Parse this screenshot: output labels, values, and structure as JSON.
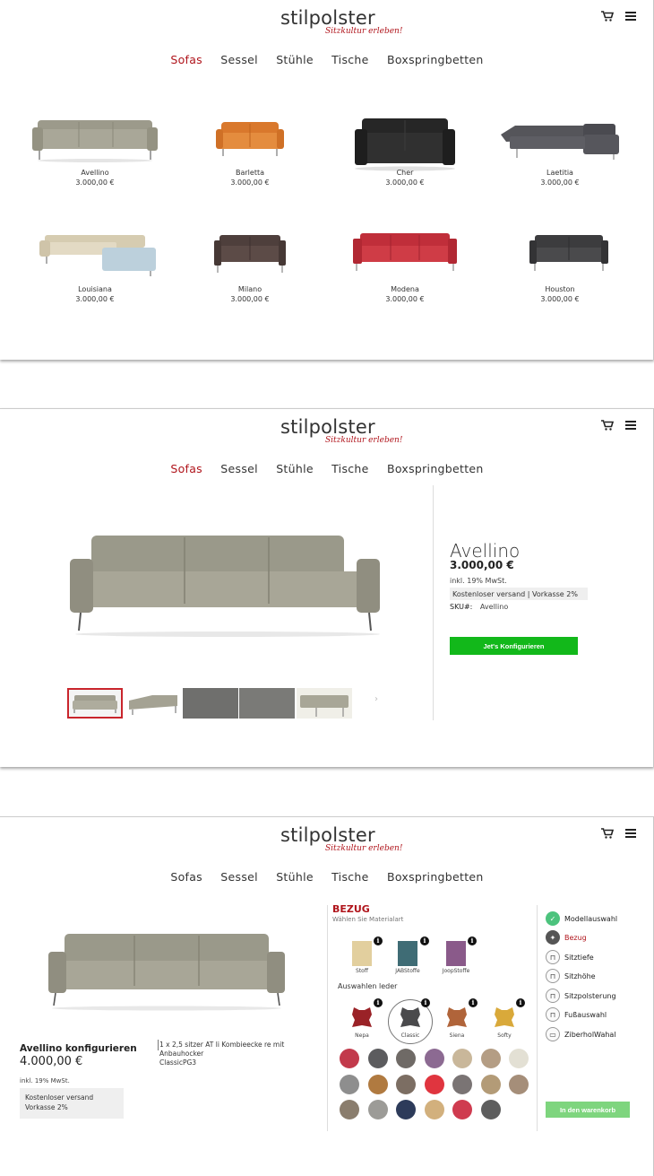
{
  "header": {
    "brand": "stilpolster",
    "tagline": "Sitzkultur erleben!",
    "nav": [
      "Sofas",
      "Sessel",
      "Stühle",
      "Tische",
      "Boxspringbetten"
    ]
  },
  "catalog": {
    "items": [
      {
        "name": "Avellino",
        "price": "3.000,00 €",
        "color": "#a4a293"
      },
      {
        "name": "Barletta",
        "price": "3.000,00 €",
        "color": "#e08a3c"
      },
      {
        "name": "Cher",
        "price": "3.000,00 €",
        "color": "#2b2b2b"
      },
      {
        "name": "Laetitia",
        "price": "3.000,00 €",
        "color": "#4c4c52"
      },
      {
        "name": "Louisiana",
        "price": "3.000,00 €",
        "color": "#d8cdb4"
      },
      {
        "name": "Milano",
        "price": "3.000,00 €",
        "color": "#5a4a46"
      },
      {
        "name": "Modena",
        "price": "3.000,00 €",
        "color": "#c4343c"
      },
      {
        "name": "Houston",
        "price": "3.000,00 €",
        "color": "#444446"
      }
    ]
  },
  "detail": {
    "name": "Avellino",
    "price": "3.000,00 €",
    "tax": "inkl. 19% MwSt.",
    "shipping": "Kostenloser versand | Vorkasse 2%",
    "sku_label": "SKU#:",
    "sku": "Avellino",
    "cta": "Jet's Konfigurieren"
  },
  "configurator": {
    "title": "Avellino konfigurieren",
    "price": "4.000,00 €",
    "tax": "inkl. 19% MwSt.",
    "shipping_line1": "Kostenloser versand",
    "shipping_line2": "Vorkasse 2%",
    "summary_line1": "1 x 2,5 sitzer AT li Kombieecke re mit Anbauhocker",
    "summary_line2": "ClassicPG3",
    "section_title": "BEZUG",
    "section_sub": "Wählen Sie Materialart",
    "materials": [
      "Stoff",
      "JABStoffe",
      "JoopStoffe"
    ],
    "leather_label": "Auswahlen leder",
    "leathers": [
      "Nepa",
      "Classic",
      "Siena",
      "Softy"
    ],
    "steps": [
      "Modellauswahl",
      "Bezug",
      "Sitztiefe",
      "Sitzhöhe",
      "Sitzpolsterung",
      "Fußauswahl",
      "ZiberholWahal"
    ],
    "cart_button": "In den warenkorb",
    "accent": "#b0151c",
    "swatches": [
      "#c23a4b",
      "#5c5c5e",
      "#6f6a66",
      "#8c6a92",
      "#c9b79a",
      "#b49d84",
      "#e3e0d4",
      "#8e8e8e",
      "#b07a40",
      "#7c6e63",
      "#e0353f",
      "#7a7474",
      "#b39b77",
      "#a58e79",
      "#8a7d6d",
      "#9c9b97",
      "#2d3b5a",
      "#d2b07d",
      "#cf3b4f",
      "#5e5e5e"
    ]
  }
}
